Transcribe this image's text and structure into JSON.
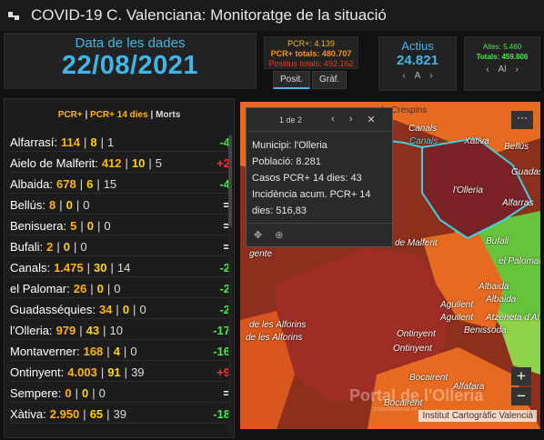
{
  "header": {
    "title": "COVID-19 C. Valenciana: Monitoratge de la situació"
  },
  "data_date": {
    "label": "Data de les dades",
    "value": "22/08/2021"
  },
  "pcr_card": {
    "line1": "PCR+: 4.139",
    "line2": "PCR+ totals: 480.707",
    "line3": "Positius totals: 492.162"
  },
  "tabs": [
    "Posit.",
    "Gràf."
  ],
  "actius": {
    "label": "Actius",
    "value": "24.821",
    "pager": "A"
  },
  "altes": {
    "line1": "Altes: 5.460",
    "line2": "Totals: 459.806",
    "pager": "Al"
  },
  "list": {
    "header": {
      "pcr": "PCR+",
      "pcr14": "PCR+ 14 dies",
      "deaths": "Morts",
      "sep": "|"
    },
    "rows": [
      {
        "name": "Alfarrasí:",
        "pcr": "114",
        "p14": "8",
        "deaths": "1",
        "diff": "-4",
        "kind": "neg"
      },
      {
        "name": "Aielo de Malferit:",
        "pcr": "412",
        "p14": "10",
        "deaths": "5",
        "diff": "+2",
        "kind": "pos"
      },
      {
        "name": "Albaida:",
        "pcr": "678",
        "p14": "6",
        "deaths": "15",
        "diff": "-4",
        "kind": "neg"
      },
      {
        "name": "Bellús:",
        "pcr": "8",
        "p14": "0",
        "deaths": "0",
        "diff": "=",
        "kind": "eq"
      },
      {
        "name": "Benisuera:",
        "pcr": "5",
        "p14": "0",
        "deaths": "0",
        "diff": "=",
        "kind": "eq"
      },
      {
        "name": "Bufali:",
        "pcr": "2",
        "p14": "0",
        "deaths": "0",
        "diff": "=",
        "kind": "eq"
      },
      {
        "name": "Canals:",
        "pcr": "1.475",
        "p14": "30",
        "deaths": "14",
        "diff": "-2",
        "kind": "neg"
      },
      {
        "name": "el Palomar:",
        "pcr": "26",
        "p14": "0",
        "deaths": "0",
        "diff": "-2",
        "kind": "neg"
      },
      {
        "name": "Guadasséquies:",
        "pcr": "34",
        "p14": "0",
        "deaths": "0",
        "diff": "-2",
        "kind": "neg"
      },
      {
        "name": "l'Olleria:",
        "pcr": "979",
        "p14": "43",
        "deaths": "10",
        "diff": "-17",
        "kind": "neg"
      },
      {
        "name": "Montaverner:",
        "pcr": "168",
        "p14": "4",
        "deaths": "0",
        "diff": "-16",
        "kind": "neg"
      },
      {
        "name": "Ontinyent:",
        "pcr": "4.003",
        "p14": "91",
        "deaths": "39",
        "diff": "+9",
        "kind": "pos"
      },
      {
        "name": "Sempere:",
        "pcr": "0",
        "p14": "0",
        "deaths": "0",
        "diff": "=",
        "kind": "eq"
      },
      {
        "name": "Xàtiva:",
        "pcr": "2.950",
        "p14": "65",
        "deaths": "39",
        "diff": "-18",
        "kind": "neg"
      }
    ]
  },
  "popup": {
    "count": "1 de 2",
    "lines": [
      "Municipi: l'Olleria",
      "Població: 8.281",
      "Casos PCR+ 14 dies: 43",
      "Incidència acum. PCR+ 14",
      "dies: 516,83"
    ]
  },
  "map": {
    "labels": {
      "canals": "Canals",
      "canals2": "Canals",
      "xativa": "Xàtiva",
      "bellus": "Bellús",
      "guadass": "Guadassé",
      "olleria": "l'Olleria",
      "alfarras": "Alfarras",
      "malferit": "de Malferit",
      "bufali": "Bufali",
      "palomar": "el Palomar",
      "albaida": "Albaida",
      "albaida2": "Albaida",
      "aguilent": "Agullent",
      "aguilent2": "Agullent",
      "benissoda": "Benissoda",
      "atzeneta": "Atzeneta d'Al",
      "ontinyent": "Ontinyent",
      "ontinyent2": "Ontinyent",
      "alforins": "de les Alforins",
      "alforins2": "de les Alforins",
      "bocairent": "Bocairent",
      "bocairent2": "Bocairent",
      "alfafara": "Alfafara",
      "crespins": "de Crespins",
      "agente": "gente"
    },
    "attribution": "Institut Cartogràfic Valencià",
    "watermark": "Portal de l'Olleria",
    "watermark_sub": "portaldolleria.es",
    "zoom_in": "+",
    "zoom_out": "−",
    "menu": "···"
  }
}
